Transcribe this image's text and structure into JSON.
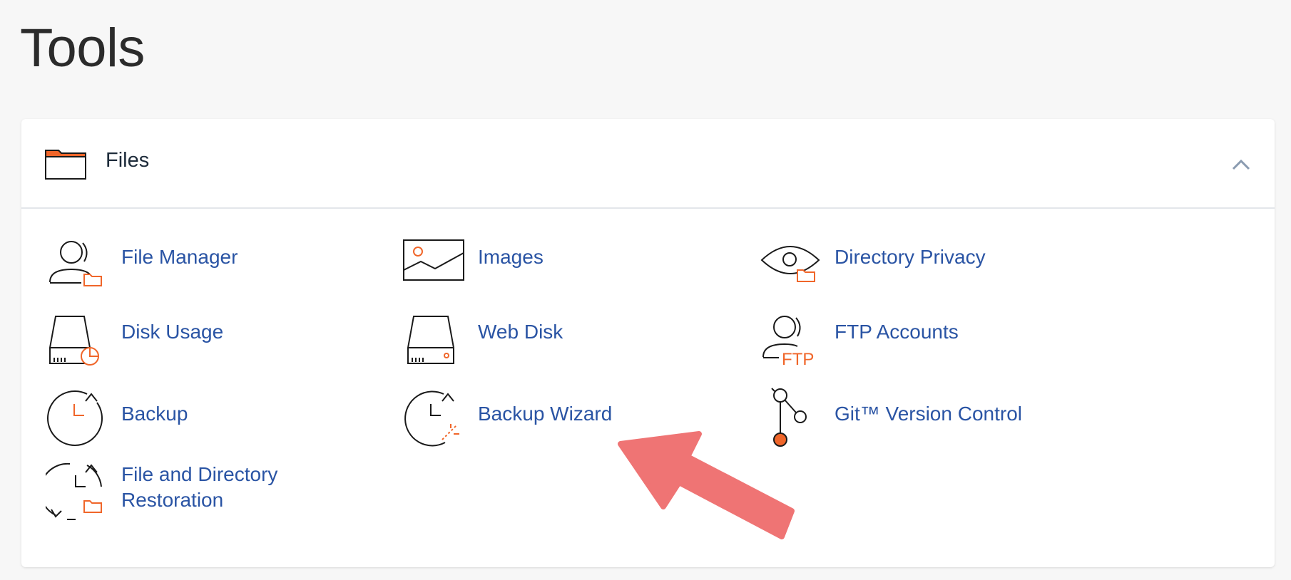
{
  "page": {
    "title": "Tools"
  },
  "section": {
    "title": "Files"
  },
  "tools": [
    {
      "label": "File Manager",
      "icon": "file-manager-icon"
    },
    {
      "label": "Images",
      "icon": "images-icon"
    },
    {
      "label": "Directory Privacy",
      "icon": "directory-privacy-icon"
    },
    {
      "label": "Disk Usage",
      "icon": "disk-usage-icon"
    },
    {
      "label": "Web Disk",
      "icon": "web-disk-icon"
    },
    {
      "label": "FTP Accounts",
      "icon": "ftp-accounts-icon",
      "icon_text": "FTP"
    },
    {
      "label": "Backup",
      "icon": "backup-icon"
    },
    {
      "label": "Backup Wizard",
      "icon": "backup-wizard-icon"
    },
    {
      "label": "Git™ Version Control",
      "icon": "git-icon"
    },
    {
      "label_line1": "File and Directory",
      "label_line2": "Restoration",
      "icon": "file-restoration-icon"
    }
  ],
  "colors": {
    "accent": "#f0662a",
    "link": "#2a54a4",
    "annotation_arrow": "#ef7474"
  }
}
